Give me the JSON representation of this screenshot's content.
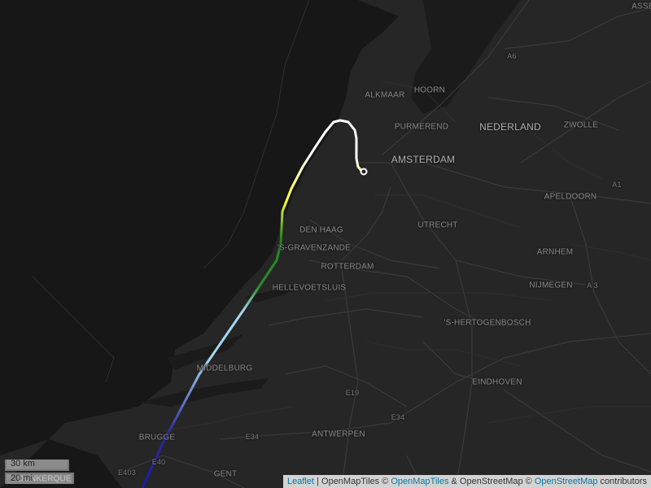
{
  "map": {
    "labels": {
      "amsterdam": "AMSTERDAM",
      "nederland": "NEDERLAND",
      "alkmaar": "ALKMAAR",
      "hoorn": "HOORN",
      "purmerend": "PURMEREND",
      "zwolle": "ZWOLLE",
      "apeldoorn": "APELDOORN",
      "den_haag": "DEN HAAG",
      "gravenzande": "'S-GRAVENZANDE",
      "rotterdam": "ROTTERDAM",
      "utrecht": "UTRECHT",
      "arnhem": "ARNHEM",
      "hellevoetsluis": "HELLEVOETSLUIS",
      "nijmegen": "NIJMEGEN",
      "hertogenbosch": "'S-HERTOGENBOSCH",
      "middelburg": "MIDDELBURG",
      "eindhoven": "EINDHOVEN",
      "antwerpen": "ANTWERPEN",
      "brugge": "BRUGGE",
      "gent": "GENT",
      "duinkerque": "DUNKERQUE",
      "assen": "ASSE",
      "a6": "A6",
      "a1": "A1",
      "a3": "A 3",
      "e19": "E19",
      "e34_a": "E34",
      "e34_b": "E34",
      "e40": "E40",
      "e403": "E403"
    },
    "track": {
      "colors": [
        "#ffffff",
        "#ffff33",
        "#1f8a1f",
        "#2a8c2a",
        "#a6d8f0",
        "#2b2b9a",
        "#1a1ab0"
      ]
    }
  },
  "scale": {
    "km": "30 km",
    "mi": "20 mi"
  },
  "attribution": {
    "leaflet": "Leaflet",
    "sep": " | ",
    "text1": "OpenMapTiles © ",
    "link1": "OpenMapTiles",
    "text2": " & OpenStreetMap © ",
    "link2": "OpenStreetMap",
    "text3": " contributors"
  }
}
